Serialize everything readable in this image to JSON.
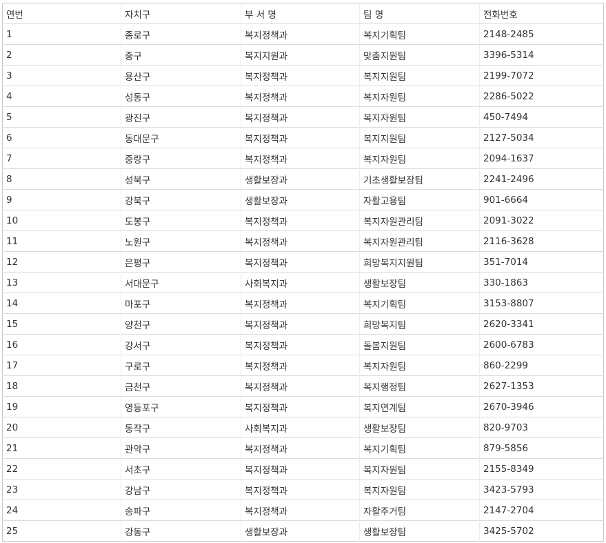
{
  "table": {
    "headers": [
      "연번",
      "자치구",
      "부 서 명",
      "팀 명",
      "전화번호"
    ],
    "rows": [
      [
        "1",
        "종로구",
        "복지정책과",
        "복지기획팀",
        "2148-2485"
      ],
      [
        "2",
        "중구",
        "복지지원과",
        "맞춤지원팀",
        "3396-5314"
      ],
      [
        "3",
        "용산구",
        "복지정책과",
        "복지지원팀",
        "2199-7072"
      ],
      [
        "4",
        "성동구",
        "복지정책과",
        "복지자원팀",
        "2286-5022"
      ],
      [
        "5",
        "광진구",
        "복지정책과",
        "복지자원팀",
        "450-7494"
      ],
      [
        "6",
        "동대문구",
        "복지정책과",
        "복지지원팀",
        "2127-5034"
      ],
      [
        "7",
        "중랑구",
        "복지정책과",
        "복지자원팀",
        "2094-1637"
      ],
      [
        "8",
        "성북구",
        "생활보장과",
        "기초생활보장팀",
        "2241-2496"
      ],
      [
        "9",
        "강북구",
        "생활보장과",
        "자활고용팀",
        "901-6664"
      ],
      [
        "10",
        "도봉구",
        "복지정책과",
        "복지자원관리팀",
        "2091-3022"
      ],
      [
        "11",
        "노원구",
        "복지정책과",
        "복지자원관리팀",
        "2116-3628"
      ],
      [
        "12",
        "은평구",
        "복지정책과",
        "희망복지지원팀",
        "351-7014"
      ],
      [
        "13",
        "서대문구",
        "사회복지과",
        "생활보장팀",
        "330-1863"
      ],
      [
        "14",
        "마포구",
        "복지정책과",
        "복지기획팀",
        "3153-8807"
      ],
      [
        "15",
        "양천구",
        "복지정책과",
        "희망복지팀",
        "2620-3341"
      ],
      [
        "16",
        "강서구",
        "복지정책과",
        "돌봄지원팀",
        "2600-6783"
      ],
      [
        "17",
        "구로구",
        "복지정책과",
        "복지자원팀",
        "860-2299"
      ],
      [
        "18",
        "금천구",
        "복지정책과",
        "복지행정팀",
        "2627-1353"
      ],
      [
        "19",
        "영등포구",
        "복지정책과",
        "복지연계팀",
        "2670-3946"
      ],
      [
        "20",
        "동작구",
        "사회복지과",
        "생활보장팀",
        "820-9703"
      ],
      [
        "21",
        "관악구",
        "복지정책과",
        "복지기획팀",
        "879-5856"
      ],
      [
        "22",
        "서초구",
        "복지정책과",
        "복지자원팀",
        "2155-8349"
      ],
      [
        "23",
        "강남구",
        "복지정책과",
        "복지자원팀",
        "3423-5793"
      ],
      [
        "24",
        "송파구",
        "복지정책과",
        "자활주거팀",
        "2147-2704"
      ],
      [
        "25",
        "강동구",
        "생활보장과",
        "생활보장팀",
        "3425-5702"
      ]
    ]
  }
}
